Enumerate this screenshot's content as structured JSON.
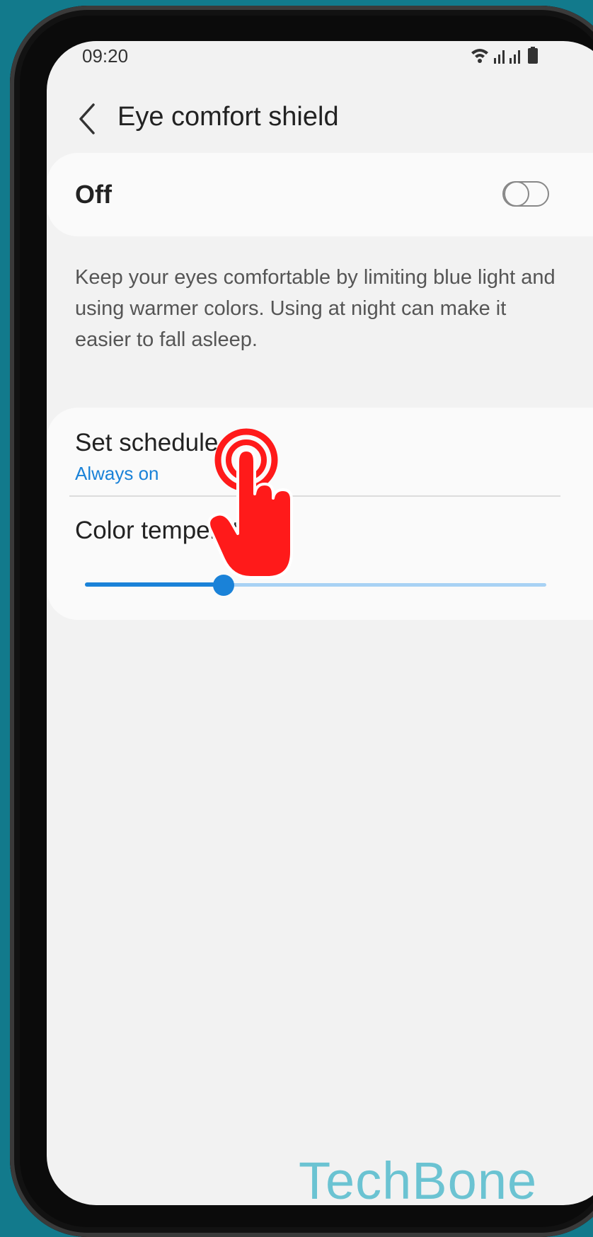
{
  "status_bar": {
    "time": "09:20"
  },
  "header": {
    "title": "Eye comfort shield"
  },
  "toggle_card": {
    "label": "Off",
    "state": "off"
  },
  "description": "Keep your eyes comfortable by limiting blue light and using warmer colors. Using at night can make it easier to fall asleep.",
  "settings": {
    "schedule_label": "Set schedule",
    "schedule_value": "Always on",
    "color_temperature_label": "Color temperature",
    "color_temperature_level": 0.3
  },
  "watermark": "TechBone",
  "colors": {
    "accent": "#1a82d8",
    "background": "#f2f2f2",
    "card": "#fafafa",
    "pointer": "#ff1a1a",
    "watermark": "#6bc3d2",
    "frame": "#127a8c"
  },
  "icons": [
    "back-arrow-icon",
    "wifi-icon",
    "signal-icon",
    "battery-icon",
    "tap-hand-icon"
  ]
}
